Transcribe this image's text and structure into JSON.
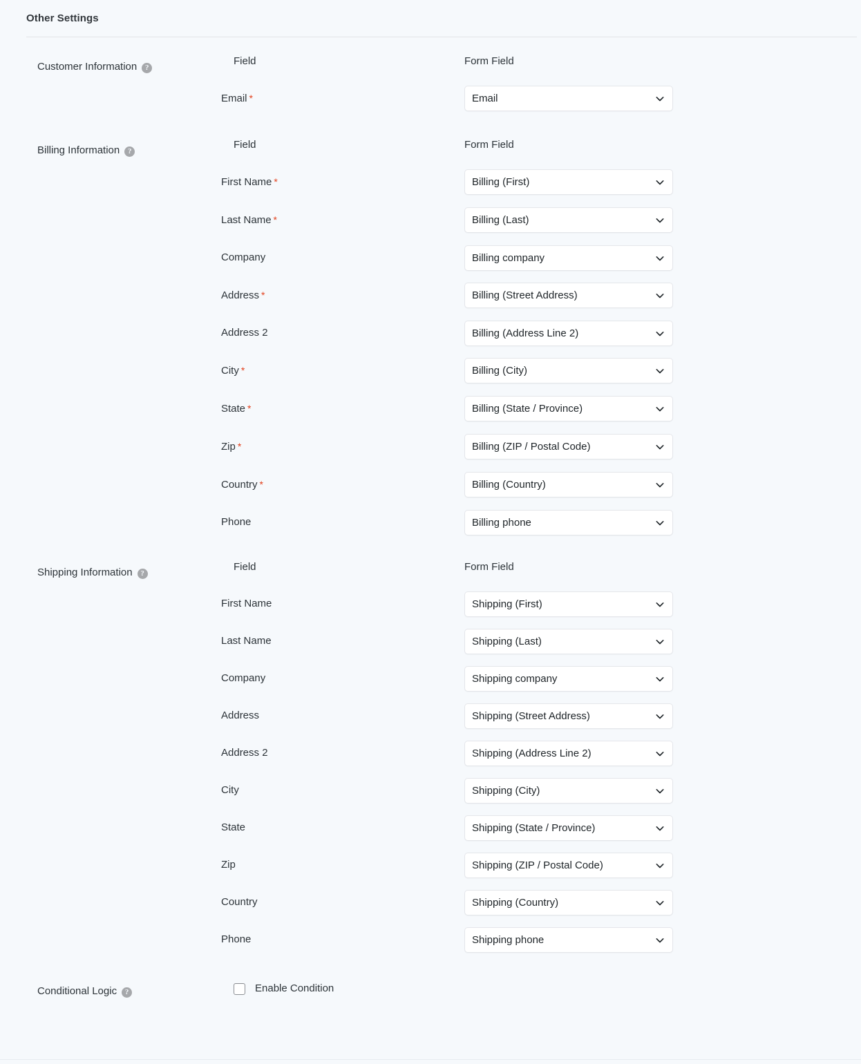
{
  "panel": {
    "title": "Other Settings"
  },
  "columns": {
    "field": "Field",
    "form_field": "Form Field"
  },
  "icons": {
    "help": "?",
    "chevron_down": "chevron-down-icon"
  },
  "colors": {
    "background": "#f6f9fc",
    "required_asterisk": "#e2401c",
    "select_border": "#e4e6ea",
    "text": "#2c3338",
    "help_icon": "#a6a8ab"
  },
  "sections": [
    {
      "key": "customer_information",
      "label": "Customer Information",
      "has_help": true,
      "rows": [
        {
          "field": "Email",
          "required": true,
          "form_field": "Email"
        }
      ]
    },
    {
      "key": "billing_information",
      "label": "Billing Information",
      "has_help": true,
      "rows": [
        {
          "field": "First Name",
          "required": true,
          "form_field": "Billing (First)"
        },
        {
          "field": "Last Name",
          "required": true,
          "form_field": "Billing (Last)"
        },
        {
          "field": "Company",
          "required": false,
          "form_field": "Billing company"
        },
        {
          "field": "Address",
          "required": true,
          "form_field": "Billing (Street Address)"
        },
        {
          "field": "Address 2",
          "required": false,
          "form_field": "Billing (Address Line 2)"
        },
        {
          "field": "City",
          "required": true,
          "form_field": "Billing (City)"
        },
        {
          "field": "State",
          "required": true,
          "form_field": "Billing (State / Province)"
        },
        {
          "field": "Zip",
          "required": true,
          "form_field": "Billing (ZIP / Postal Code)"
        },
        {
          "field": "Country",
          "required": true,
          "form_field": "Billing (Country)"
        },
        {
          "field": "Phone",
          "required": false,
          "form_field": "Billing phone"
        }
      ]
    },
    {
      "key": "shipping_information",
      "label": "Shipping Information",
      "has_help": true,
      "rows": [
        {
          "field": "First Name",
          "required": false,
          "form_field": "Shipping (First)"
        },
        {
          "field": "Last Name",
          "required": false,
          "form_field": "Shipping (Last)"
        },
        {
          "field": "Company",
          "required": false,
          "form_field": "Shipping company"
        },
        {
          "field": "Address",
          "required": false,
          "form_field": "Shipping (Street Address)"
        },
        {
          "field": "Address 2",
          "required": false,
          "form_field": "Shipping (Address Line 2)"
        },
        {
          "field": "City",
          "required": false,
          "form_field": "Shipping (City)"
        },
        {
          "field": "State",
          "required": false,
          "form_field": "Shipping (State / Province)"
        },
        {
          "field": "Zip",
          "required": false,
          "form_field": "Shipping (ZIP / Postal Code)"
        },
        {
          "field": "Country",
          "required": false,
          "form_field": "Shipping (Country)"
        },
        {
          "field": "Phone",
          "required": false,
          "form_field": "Shipping phone"
        }
      ]
    }
  ],
  "conditional_logic": {
    "label": "Conditional Logic",
    "has_help": true,
    "checkbox_label": "Enable Condition",
    "checked": false
  }
}
